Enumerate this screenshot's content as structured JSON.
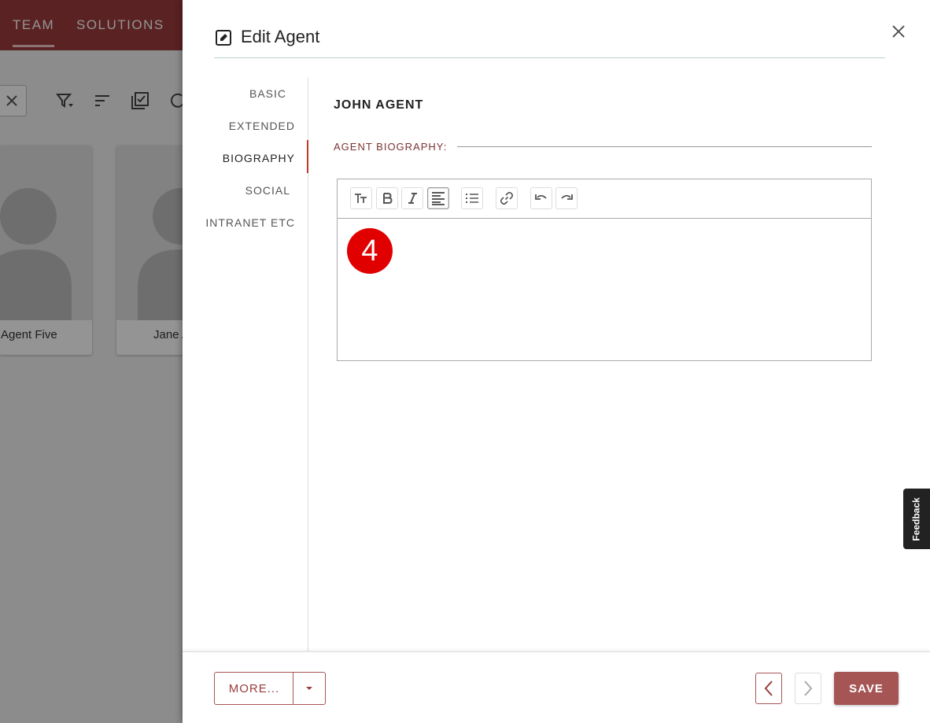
{
  "background": {
    "tabs": [
      {
        "label": "TEAM",
        "active": true
      },
      {
        "label": "SOLUTIONS",
        "active": false
      }
    ],
    "cards": [
      {
        "name": "Agent Five"
      },
      {
        "name": "Jane A"
      }
    ]
  },
  "dialog": {
    "title": "Edit Agent",
    "nav": [
      {
        "label": "BASIC"
      },
      {
        "label": "EXTENDED"
      },
      {
        "label": "BIOGRAPHY",
        "active": true
      },
      {
        "label": "SOCIAL"
      },
      {
        "label": "INTRANET ETC"
      }
    ],
    "agent_name": "JOHN AGENT",
    "bio_label": "AGENT BIOGRAPHY:",
    "editor": {
      "toolbar": [
        "text-size-icon",
        "bold-icon",
        "italic-icon",
        "align-left-icon",
        "list-icon",
        "link-icon",
        "undo-icon",
        "redo-icon"
      ],
      "step_badge": "4"
    },
    "footer": {
      "more_label": "MORE...",
      "save_label": "SAVE"
    }
  },
  "feedback_label": "Feedback",
  "colors": {
    "brand": "#9b3c3c",
    "save_button": "#a65555",
    "nav_indicator": "#c0392b",
    "step_badge": "#e00000"
  }
}
